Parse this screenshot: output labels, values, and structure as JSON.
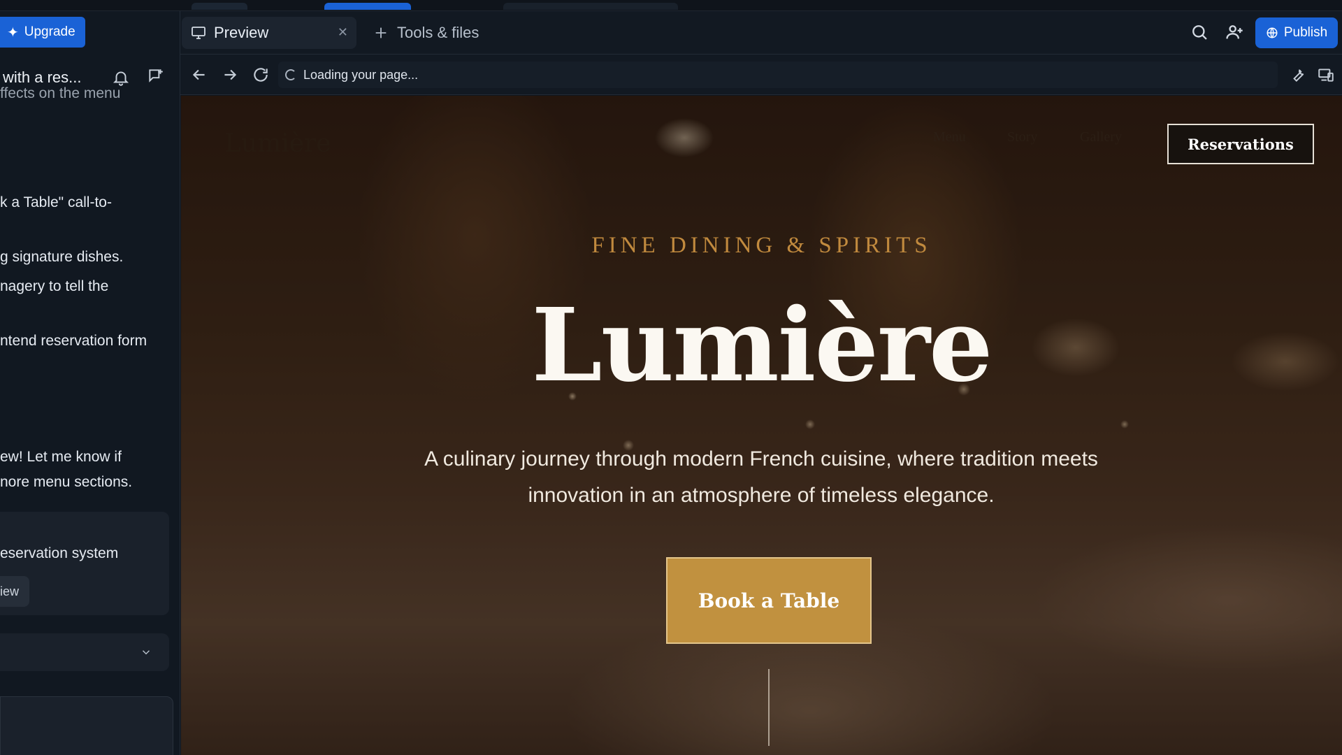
{
  "sidebar": {
    "upgrade_label": "Upgrade",
    "chat_title": "with a res...",
    "messages": [
      "ffects on the menu",
      "k a Table\" call-to-",
      "g signature dishes.",
      "nagery to tell the",
      "ntend reservation form",
      "ew! Let me know if",
      "nore menu sections.",
      "eservation system"
    ],
    "chip_label": "iew"
  },
  "toolbar": {
    "tab_preview": "Preview",
    "tab_tools": "Tools & files",
    "publish_label": "Publish"
  },
  "address": {
    "status_text": "Loading your page..."
  },
  "site": {
    "logo": "Lumière",
    "nav": [
      "Menu",
      "Story",
      "Gallery"
    ],
    "reservations": "Reservations",
    "kicker": "FINE DINING & SPIRITS",
    "title": "Lumière",
    "subtitle": "A culinary journey through modern French cuisine, where tradition meets innovation in an atmosphere of timeless elegance.",
    "cta": "Book a Table"
  },
  "colors": {
    "accent_blue": "#1a62d6",
    "gold": "#c1913f",
    "kicker_gold": "#c18a3e"
  }
}
